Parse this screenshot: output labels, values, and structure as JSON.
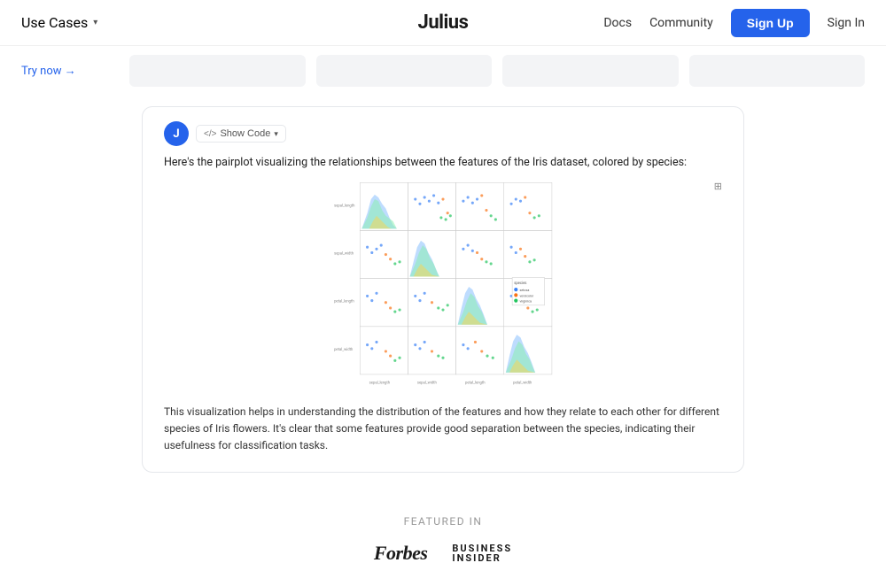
{
  "nav": {
    "use_cases_label": "Use Cases",
    "logo": "Julius",
    "docs_label": "Docs",
    "community_label": "Community",
    "signup_label": "Sign Up",
    "signin_label": "Sign In"
  },
  "hero": {
    "try_now_label": "Try now →"
  },
  "chat": {
    "avatar_letter": "J",
    "show_code_label": "Show Code",
    "description": "Here's the pairplot visualizing the relationships between the features of the Iris dataset, colored by species:",
    "analysis": "This visualization helps in understanding the distribution of the features and how they relate to each other for different species of Iris flowers. It's clear that some features provide good separation between the species, indicating their usefulness for classification tasks.",
    "expand_icon": "⊞"
  },
  "featured": {
    "label": "FEATURED IN",
    "forbes_label": "Forbes",
    "bi_business": "BUSINESS",
    "bi_insider": "INSIDER"
  },
  "colors": {
    "blue": "#2563eb",
    "orange": "#f59e0b",
    "green": "#10b981",
    "scatter_blue": "#3b82f6",
    "scatter_orange": "#f97316",
    "scatter_green": "#22c55e"
  }
}
